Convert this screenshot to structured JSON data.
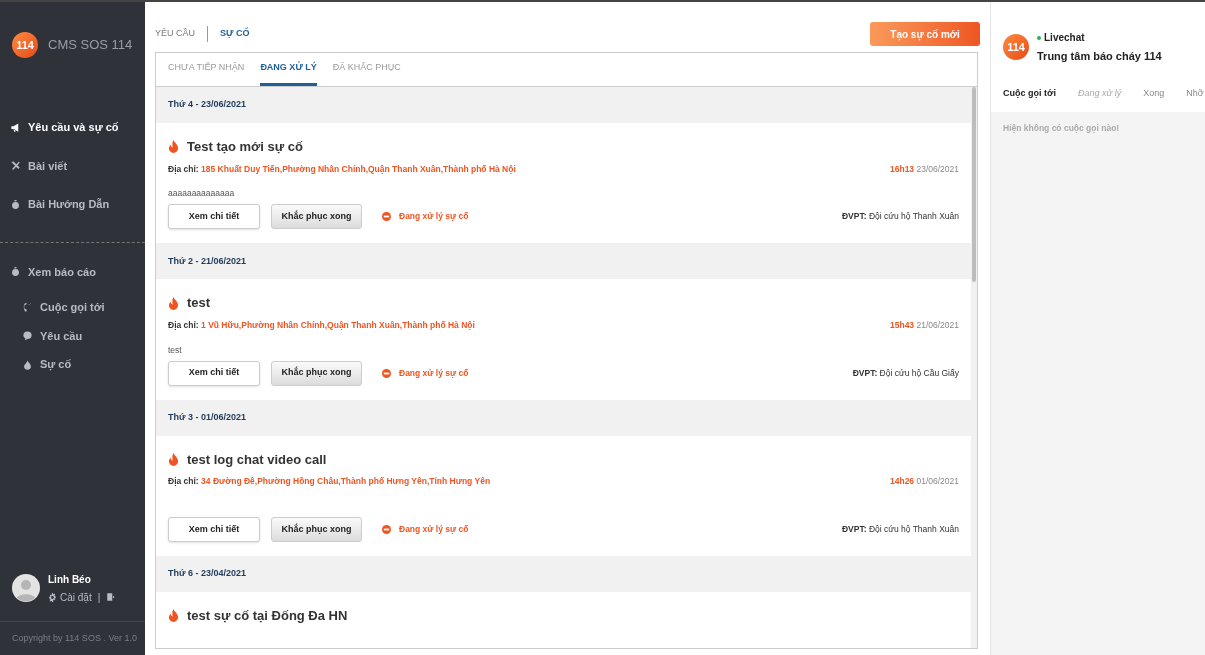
{
  "sidebar": {
    "logo": "114",
    "title": "CMS SOS 114",
    "items": [
      {
        "label": "Yêu cầu và sự cố",
        "selected": true
      },
      {
        "label": "Bài viết",
        "selected": false
      },
      {
        "label": "Bài Hướng Dẫn",
        "selected": false
      }
    ],
    "report": {
      "label": "Xem báo cáo",
      "selected": false,
      "children": [
        {
          "label": "Cuộc gọi tới",
          "selected": false
        },
        {
          "label": "Yêu cầu",
          "selected": false
        },
        {
          "label": "Sự cố",
          "selected": false
        }
      ]
    },
    "user": {
      "name": "Linh Béo",
      "settings": "Cài đặt",
      "separator": "|"
    },
    "copyright": "Copyright by 114 SOS . Ver 1.0"
  },
  "main": {
    "top_tabs": [
      {
        "label": "YÊU CẦU",
        "selected": false
      },
      {
        "label": "SỰ CỐ",
        "selected": true
      }
    ],
    "new_button": "Tạo sự cố mới",
    "status_tabs": [
      {
        "label": "CHƯA TIẾP NHẬN",
        "selected": false
      },
      {
        "label": "ĐANG XỬ LÝ",
        "selected": true
      },
      {
        "label": "ĐÃ KHẮC PHỤC",
        "selected": false
      }
    ],
    "groups": [
      {
        "date": "Thứ 4 - 23/06/2021",
        "incidents": [
          {
            "title": "Test tạo mới sự cố",
            "address_label": "Địa chỉ:",
            "address": "185 Khuất Duy Tiến,Phường Nhân Chính,Quận Thanh Xuân,Thành phố Hà Nội",
            "time": "16h13",
            "date": "23/06/2021",
            "description": "aaaaaaaaaaaaaa",
            "view_button": "Xem chi tiết",
            "done_button": "Khắc phục xong",
            "status": "Đang xử lý sự cố",
            "unit_label": "ĐVPT:",
            "unit": "Đội cứu hộ Thanh Xuân"
          }
        ]
      },
      {
        "date": "Thứ 2 - 21/06/2021",
        "incidents": [
          {
            "title": "test",
            "address_label": "Địa chỉ:",
            "address": "1 Vũ Hữu,Phường Nhân Chính,Quận Thanh Xuân,Thành phố Hà Nội",
            "time": "15h43",
            "date": "21/06/2021",
            "description": "test",
            "view_button": "Xem chi tiết",
            "done_button": "Khắc phục xong",
            "status": "Đang xử lý sự cố",
            "unit_label": "ĐVPT:",
            "unit": "Đội cứu hộ Cầu Giấy"
          }
        ]
      },
      {
        "date": "Thứ 3 - 01/06/2021",
        "incidents": [
          {
            "title": "test log chat video call",
            "address_label": "Địa chỉ:",
            "address": "34 Đường Đê,Phường Hồng Châu,Thành phố Hưng Yên,Tỉnh Hưng Yên",
            "time": "14h26",
            "date": "01/06/2021",
            "view_button": "Xem chi tiết",
            "done_button": "Khắc phục xong",
            "status": "Đang xử lý sự cố",
            "unit_label": "ĐVPT:",
            "unit": "Đội cứu hộ Thanh Xuân"
          }
        ]
      },
      {
        "date": "Thứ 6 - 23/04/2021",
        "incidents": [
          {
            "title": "test sự cố tại Đống Đa HN"
          }
        ]
      }
    ]
  },
  "livechat": {
    "logo": "114",
    "status": "Livechat",
    "online": true,
    "center": "Trung tâm báo cháy 114",
    "tabs": [
      {
        "label": "Cuộc gọi tới",
        "selected": true,
        "disabled": false
      },
      {
        "label": "Đang xử lý",
        "selected": false,
        "disabled": true
      },
      {
        "label": "Xong",
        "selected": false,
        "disabled": false
      },
      {
        "label": "Nhỡ",
        "selected": false,
        "disabled": false
      }
    ],
    "empty_message": "Hiện không có cuộc gọi nào!"
  }
}
